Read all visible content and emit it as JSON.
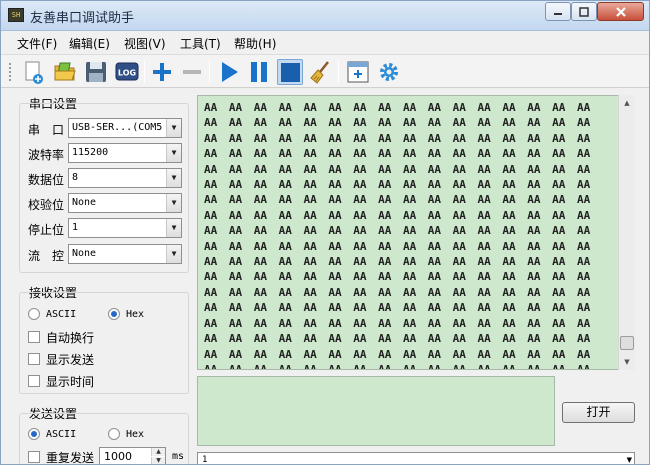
{
  "window": {
    "title": "友善串口调试助手",
    "app_icon_text": "SH"
  },
  "menu": [
    "文件(F)",
    "编辑(E)",
    "视图(V)",
    "工具(T)",
    "帮助(H)"
  ],
  "toolbar": {
    "icons": [
      "new-file-icon",
      "open-folder-icon",
      "save-icon",
      "log-icon",
      "add-icon",
      "remove-icon",
      "play-icon",
      "pause-icon",
      "stop-icon",
      "clear-broom-icon",
      "add-window-icon",
      "settings-gear-icon"
    ],
    "log_label": "LOG",
    "colors": {
      "blue": "#1a73c8",
      "gray": "#b5b5b5"
    }
  },
  "serial": {
    "title": "串口设置",
    "port_label": "串　口",
    "port_value": "USB-SER...(COM5",
    "baud_label": "波特率",
    "baud_value": "115200",
    "databits_label": "数据位",
    "databits_value": "8",
    "parity_label": "校验位",
    "parity_value": "None",
    "stopbits_label": "停止位",
    "stopbits_value": "1",
    "flow_label": "流　控",
    "flow_value": "None"
  },
  "receive": {
    "title": "接收设置",
    "ascii_label": "ASCII",
    "hex_label": "Hex",
    "selected": "Hex",
    "auto_newline_label": "自动换行",
    "show_send_label": "显示发送",
    "show_time_label": "显示时间",
    "content": "AA AA AA AA AA AA AA AA AA AA AA AA AA AA AA AA AA AA AA AA AA AA AA AA AA AA AA AA AA AA AA AA AA AA AA AA AA AA AA AA AA AA AA AA AA AA AA AA AA AA AA AA AA AA AA AA AA AA AA AA AA AA AA AA AA AA AA AA AA AA AA AA AA AA AA AA AA AA AA AA AA AA AA AA AA AA AA AA AA AA AA AA AA AA AA AA AA AA AA AA AA AA AA AA AA AA AA AA AA AA AA AA AA AA AA AA AA AA AA AA AA AA AA AA AA AA AA AA AA AA AA AA AA AA AA AA AA AA AA AA AA AA AA AA AA AA AA AA AA AA AA AA AA AA AA AA AA AA AA AA AA AA AA AA AA AA AA AA AA AA AA AA AA AA AA AA AA AA AA AA AA AA AA AA AA AA AA AA AA AA AA AA AA AA AA AA AA AA AA AA AA AA AA AA AA AA AA AA AA AA AA AA AA AA AA AA AA AA AA AA AA AA AA AA AA AA AA AA AA AA AA AA AA AA AA AA AA AA AA AA AA AA AA AA AA AA AA AA AA AA AA AA AA AA AA AA AA AA AA AA AA AA AA AA AA AA AA AA AA AA AA AA AA AA AA AA AA AA AA AA AA AA AA AA AA AA AA AA AA AA AA AA AA AA AA AA AA AA AA AA AA AA AA AA AA AA AA AA AA AA AA AA AA AA AA AA AA AA AA AA AA AA AA AA AA AA AA AA AA AA AA AA AA AA AA AA AA AA AA AA AA AA AA AA AA AA AA AA AA AA AA AA AA AA AA AA AA AA AA AA AA AA AA AA AA AA AA AA AA AA AA AA AA AA AA AA AA AA AA AA AA AA AA AA AA AA AA AA"
  },
  "send": {
    "title": "发送设置",
    "ascii_label": "ASCII",
    "hex_label": "Hex",
    "selected": "ASCII",
    "repeat_label": "重复发送",
    "interval_value": "1000",
    "interval_unit": "ms",
    "open_button": "打开",
    "bottom_combo_value": "1"
  },
  "colors": {
    "receive_bg": "#cde8cd",
    "window_bg": "#f0f0f0",
    "title_bg": "#c3d8ef"
  }
}
